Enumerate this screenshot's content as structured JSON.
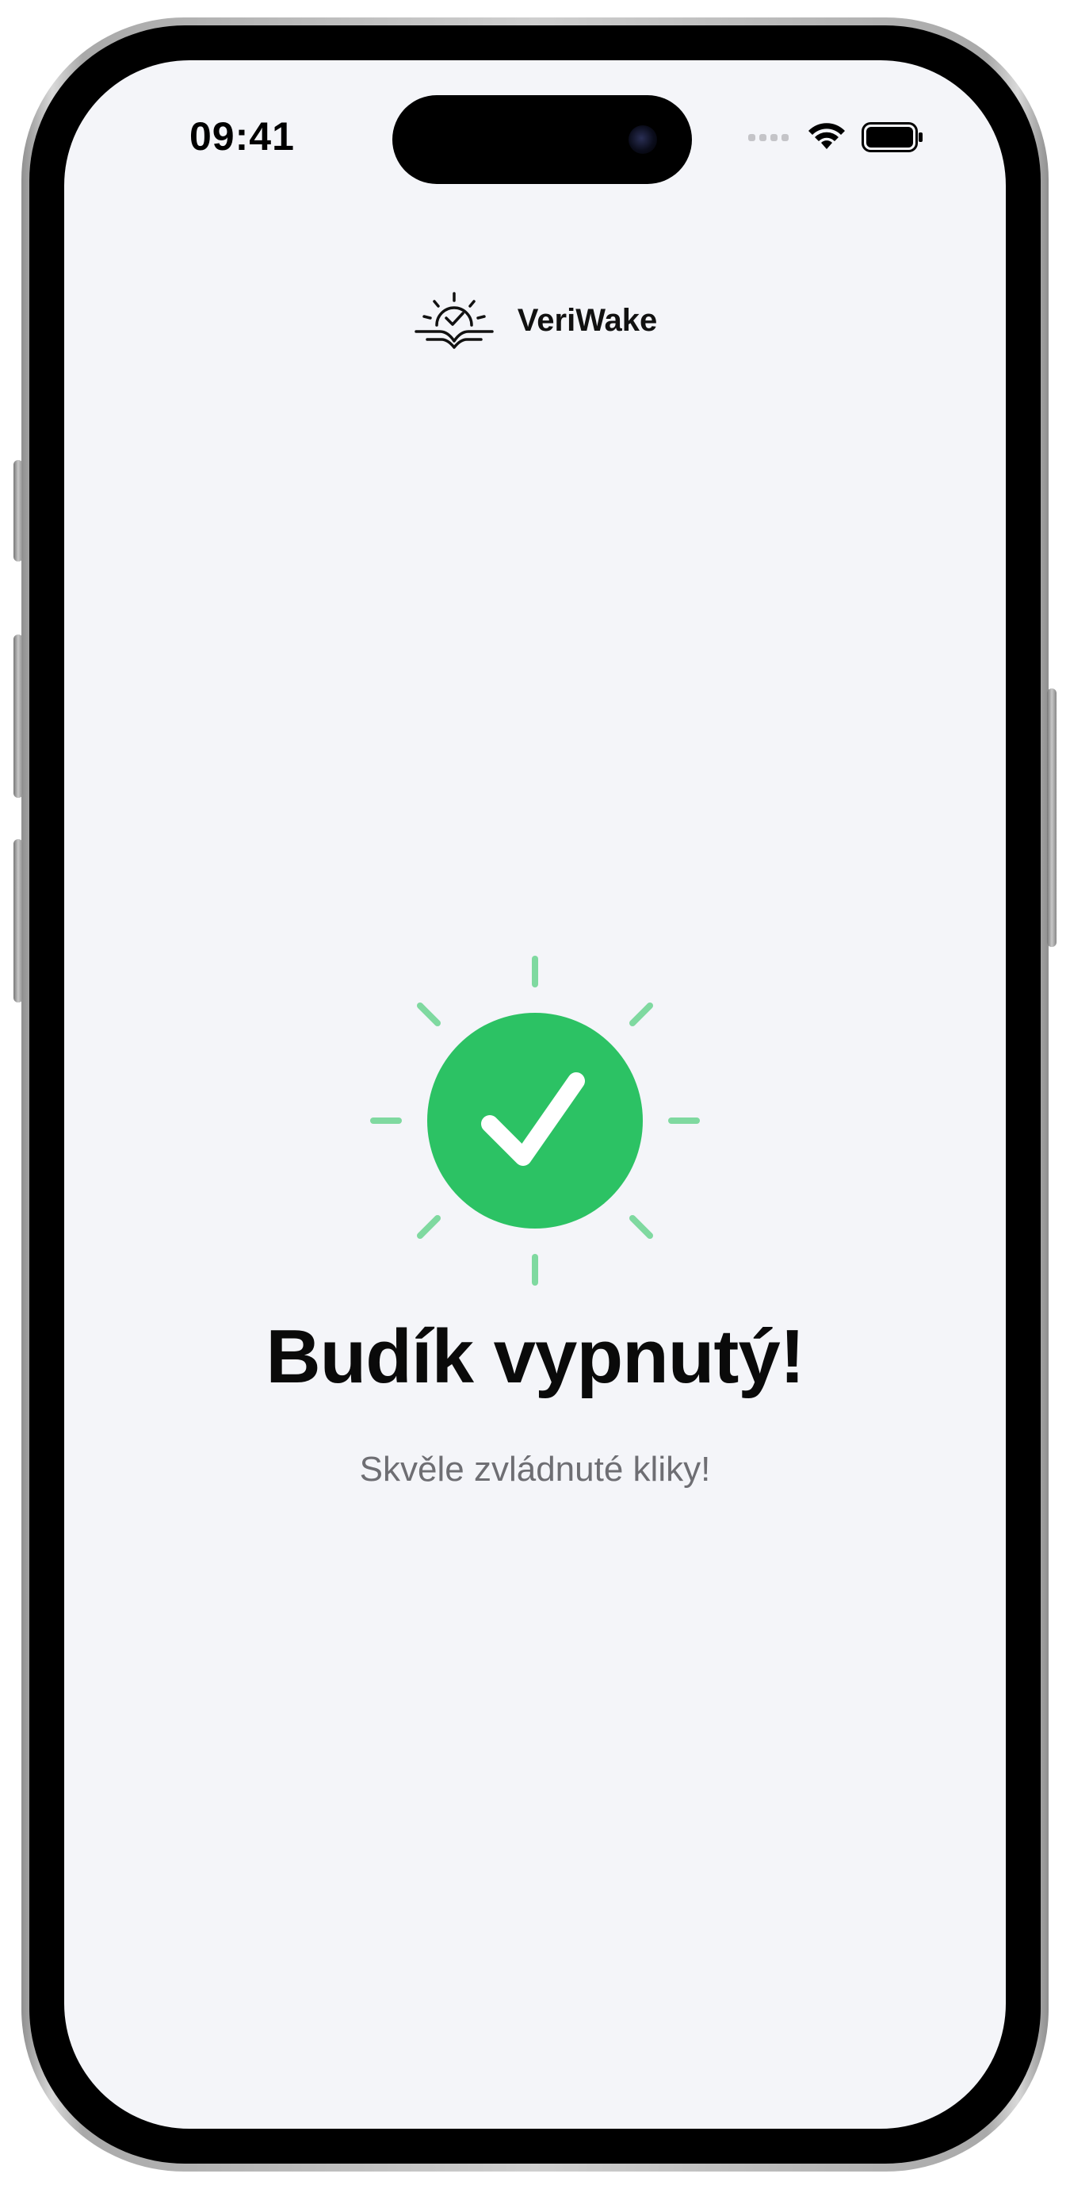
{
  "status_bar": {
    "time": "09:41",
    "signal_icon": "cellular-signal-icon",
    "wifi_icon": "wifi-icon",
    "battery_icon": "battery-icon"
  },
  "header": {
    "app_name": "VeriWake",
    "logo_icon": "sunrise-check-logo-icon"
  },
  "result": {
    "icon": "success-check-icon",
    "title": "Budík vypnutý!",
    "subtitle": "Skvěle zvládnuté kliky!"
  },
  "colors": {
    "background": "#f4f5f9",
    "accent_green": "#2cc264",
    "ray_green": "#7fd9a0",
    "title_text": "#0a0a0a",
    "subtitle_text": "#6e6e73"
  }
}
